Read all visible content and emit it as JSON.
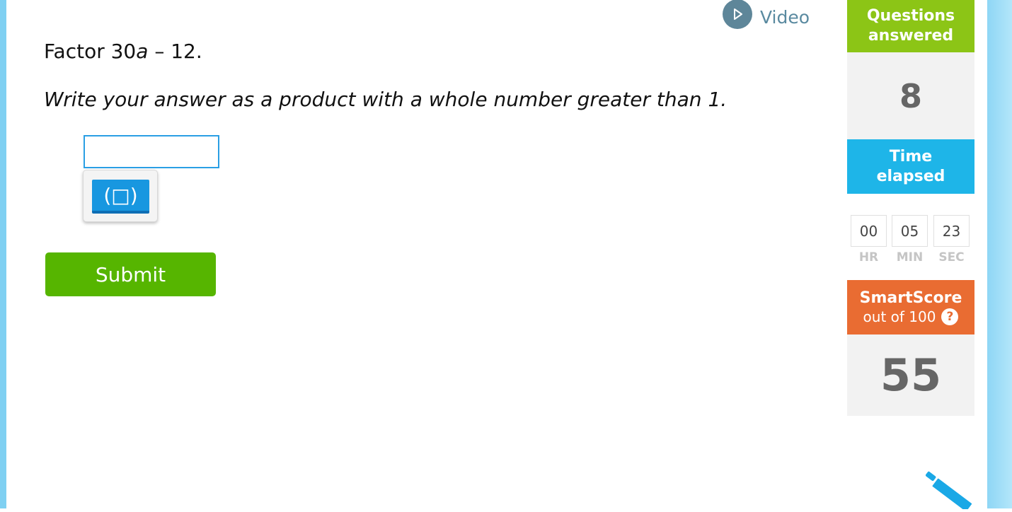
{
  "video": {
    "label": "Video",
    "icon": "play-icon"
  },
  "question": {
    "prefix": "Factor 30",
    "variable": "a",
    "suffix": " – 12.",
    "instruction": "Write your answer as a product with a whole number greater than 1."
  },
  "answer": {
    "value": "",
    "keypad_button": "(□)"
  },
  "submit": {
    "label": "Submit"
  },
  "sidebar": {
    "questions_answered_label_1": "Questions",
    "questions_answered_label_2": "answered",
    "questions_answered_value": "8",
    "time_label_1": "Time",
    "time_label_2": "elapsed",
    "timer": {
      "hr": "00",
      "min": "05",
      "sec": "23"
    },
    "timer_labels": {
      "hr": "HR",
      "min": "MIN",
      "sec": "SEC"
    },
    "smartscore_title": "SmartScore",
    "smartscore_subtitle": "out of 100",
    "smartscore_help": "?",
    "smartscore_value": "55"
  },
  "colors": {
    "green": "#8cc516",
    "blue": "#1eb5e8",
    "orange": "#e96c32",
    "submit_green": "#56b500",
    "keypad_blue": "#1897e0"
  },
  "icons": {
    "pencil": "pencil-icon",
    "help": "help-circle-icon"
  }
}
